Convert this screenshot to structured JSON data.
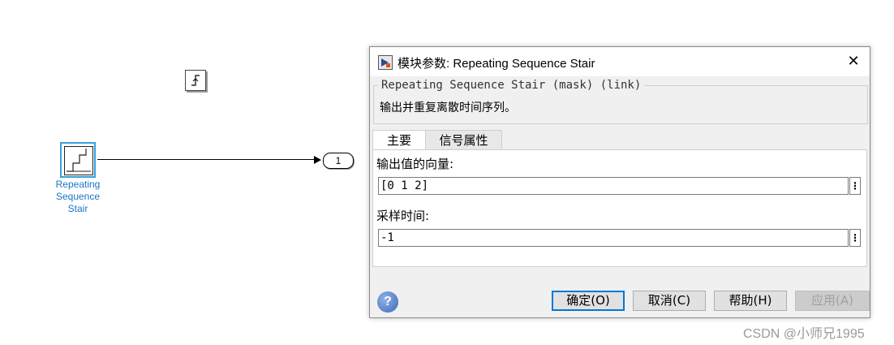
{
  "canvas": {
    "block_label": "Repeating\nSequence\nStair",
    "outport_label": "1"
  },
  "dialog": {
    "title": "模块参数: Repeating Sequence Stair",
    "group_title": "Repeating Sequence Stair (mask) (link)",
    "description": "输出并重复离散时间序列。",
    "tabs": [
      "主要",
      "信号属性"
    ],
    "fields": {
      "vector_label": "输出值的向量:",
      "vector_value": "[0 1 2]",
      "sample_label": "采样时间:",
      "sample_value": "-1"
    },
    "buttons": {
      "ok": "确定(O)",
      "cancel": "取消(C)",
      "help": "帮助(H)",
      "apply": "应用(A)"
    }
  },
  "watermark": "CSDN @小师兄1995",
  "icons": {
    "trigger": "step-trigger-icon",
    "stair": "stair-icon",
    "more": "more-vertical-icon",
    "help": "help-icon",
    "close": "close-icon"
  }
}
